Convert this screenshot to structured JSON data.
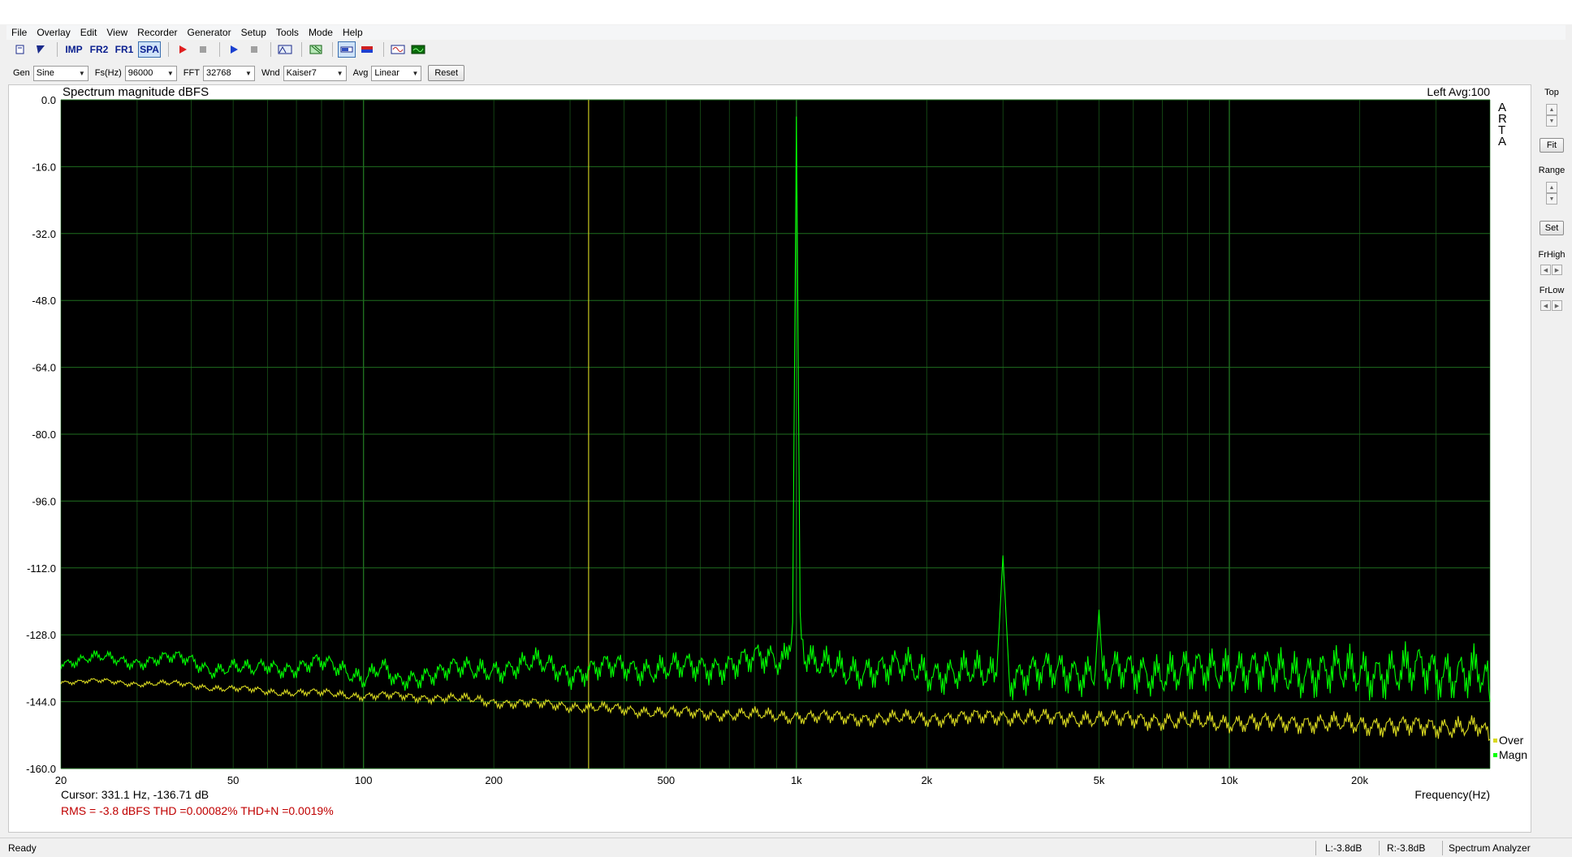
{
  "menu": [
    "File",
    "Overlay",
    "Edit",
    "View",
    "Recorder",
    "Generator",
    "Setup",
    "Tools",
    "Mode",
    "Help"
  ],
  "toolbar": {
    "imp_label": "IMP",
    "fr2_label": "FR2",
    "fr1_label": "FR1",
    "spa_label": "SPA"
  },
  "controls": {
    "gen_label": "Gen",
    "gen_value": "Sine",
    "fs_label": "Fs(Hz)",
    "fs_value": "96000",
    "fft_label": "FFT",
    "fft_value": "32768",
    "wnd_label": "Wnd",
    "wnd_value": "Kaiser7",
    "avg_label": "Avg",
    "avg_value": "Linear",
    "reset_label": "Reset"
  },
  "side": {
    "top_label": "Top",
    "fit_label": "Fit",
    "range_label": "Range",
    "set_label": "Set",
    "frhigh_label": "FrHigh",
    "frlow_label": "FrLow"
  },
  "status": {
    "ready": "Ready",
    "left_level": "L:-3.8dB",
    "right_level": "R:-3.8dB",
    "mode": "Spectrum Analyzer"
  },
  "chart_data": {
    "type": "line",
    "title": "Spectrum magnitude dBFS",
    "channel_info": "Left  Avg:100",
    "watermark": "ARTA",
    "xlabel": "Frequency(Hz)",
    "x_scale": "log",
    "xlim": [
      20,
      40000
    ],
    "ylim": [
      -160,
      0
    ],
    "yticks": [
      0,
      -16,
      -32,
      -48,
      -64,
      -80,
      -96,
      -112,
      -128,
      -144,
      -160
    ],
    "ytick_labels": [
      "0.0",
      "-16.0",
      "-32.0",
      "-48.0",
      "-64.0",
      "-80.0",
      "-96.0",
      "-112.0",
      "-128.0",
      "-144.0",
      "-160.0"
    ],
    "xtick_values": [
      20,
      50,
      100,
      200,
      500,
      1000,
      2000,
      5000,
      10000,
      20000
    ],
    "xtick_labels": [
      "20",
      "50",
      "100",
      "200",
      "500",
      "1k",
      "2k",
      "5k",
      "10k",
      "20k"
    ],
    "grid": true,
    "cursor_hz": 331.1,
    "cursor_text": "Cursor:   331.1 Hz, -136.71 dB",
    "measurements_text": "RMS =   -3.8 dBFS   THD =0.00082%   THD+N =0.0019%",
    "colors": {
      "background": "#000000",
      "grid": "#1f6e1f",
      "magn": "#00ff00",
      "over": "#d8d820",
      "cursor": "#c8c820",
      "measurements": "#c00000"
    },
    "series": [
      {
        "name": "Magn",
        "color": "#00ff00",
        "x": [
          20,
          25,
          30,
          35,
          40,
          45,
          50,
          55,
          60,
          70,
          80,
          90,
          100,
          110,
          120,
          140,
          160,
          180,
          200,
          250,
          300,
          350,
          400,
          500,
          600,
          700,
          800,
          900,
          950,
          980,
          1000,
          1020,
          1050,
          1100,
          1300,
          1500,
          1800,
          2000,
          2500,
          2900,
          3000,
          3100,
          3500,
          4000,
          4500,
          4900,
          5000,
          5100,
          6000,
          8000,
          10000,
          12000,
          15000,
          20000,
          25000,
          28000,
          30000,
          33000,
          36000,
          39000,
          40000
        ],
        "y": [
          -134,
          -134,
          -134,
          -134,
          -134,
          -136,
          -136,
          -137,
          -135,
          -136,
          -135,
          -136,
          -138,
          -136,
          -140,
          -137,
          -136,
          -137,
          -136,
          -135,
          -137,
          -136,
          -136,
          -136,
          -136,
          -135,
          -134,
          -134,
          -133,
          -125,
          -4,
          -125,
          -133,
          -135,
          -137,
          -136,
          -136,
          -137,
          -137,
          -138,
          -109,
          -138,
          -137,
          -137,
          -137,
          -137,
          -122,
          -137,
          -137,
          -137,
          -136,
          -137,
          -137,
          -137,
          -137,
          -136,
          -137,
          -137,
          -137,
          -138,
          -144
        ]
      },
      {
        "name": "Over",
        "color": "#d8d820",
        "x": [
          20,
          30,
          40,
          50,
          60,
          80,
          100,
          150,
          200,
          300,
          400,
          500,
          700,
          1000,
          1500,
          2000,
          3000,
          4000,
          5000,
          7000,
          10000,
          15000,
          20000,
          30000,
          38000,
          40000
        ],
        "y": [
          -139,
          -139.5,
          -140,
          -141,
          -141.5,
          -142,
          -142.5,
          -143,
          -144,
          -145,
          -146,
          -146.5,
          -147,
          -147.5,
          -148,
          -148,
          -147.5,
          -148,
          -148,
          -148.5,
          -149,
          -149,
          -149.5,
          -150,
          -150,
          -153
        ]
      }
    ]
  }
}
